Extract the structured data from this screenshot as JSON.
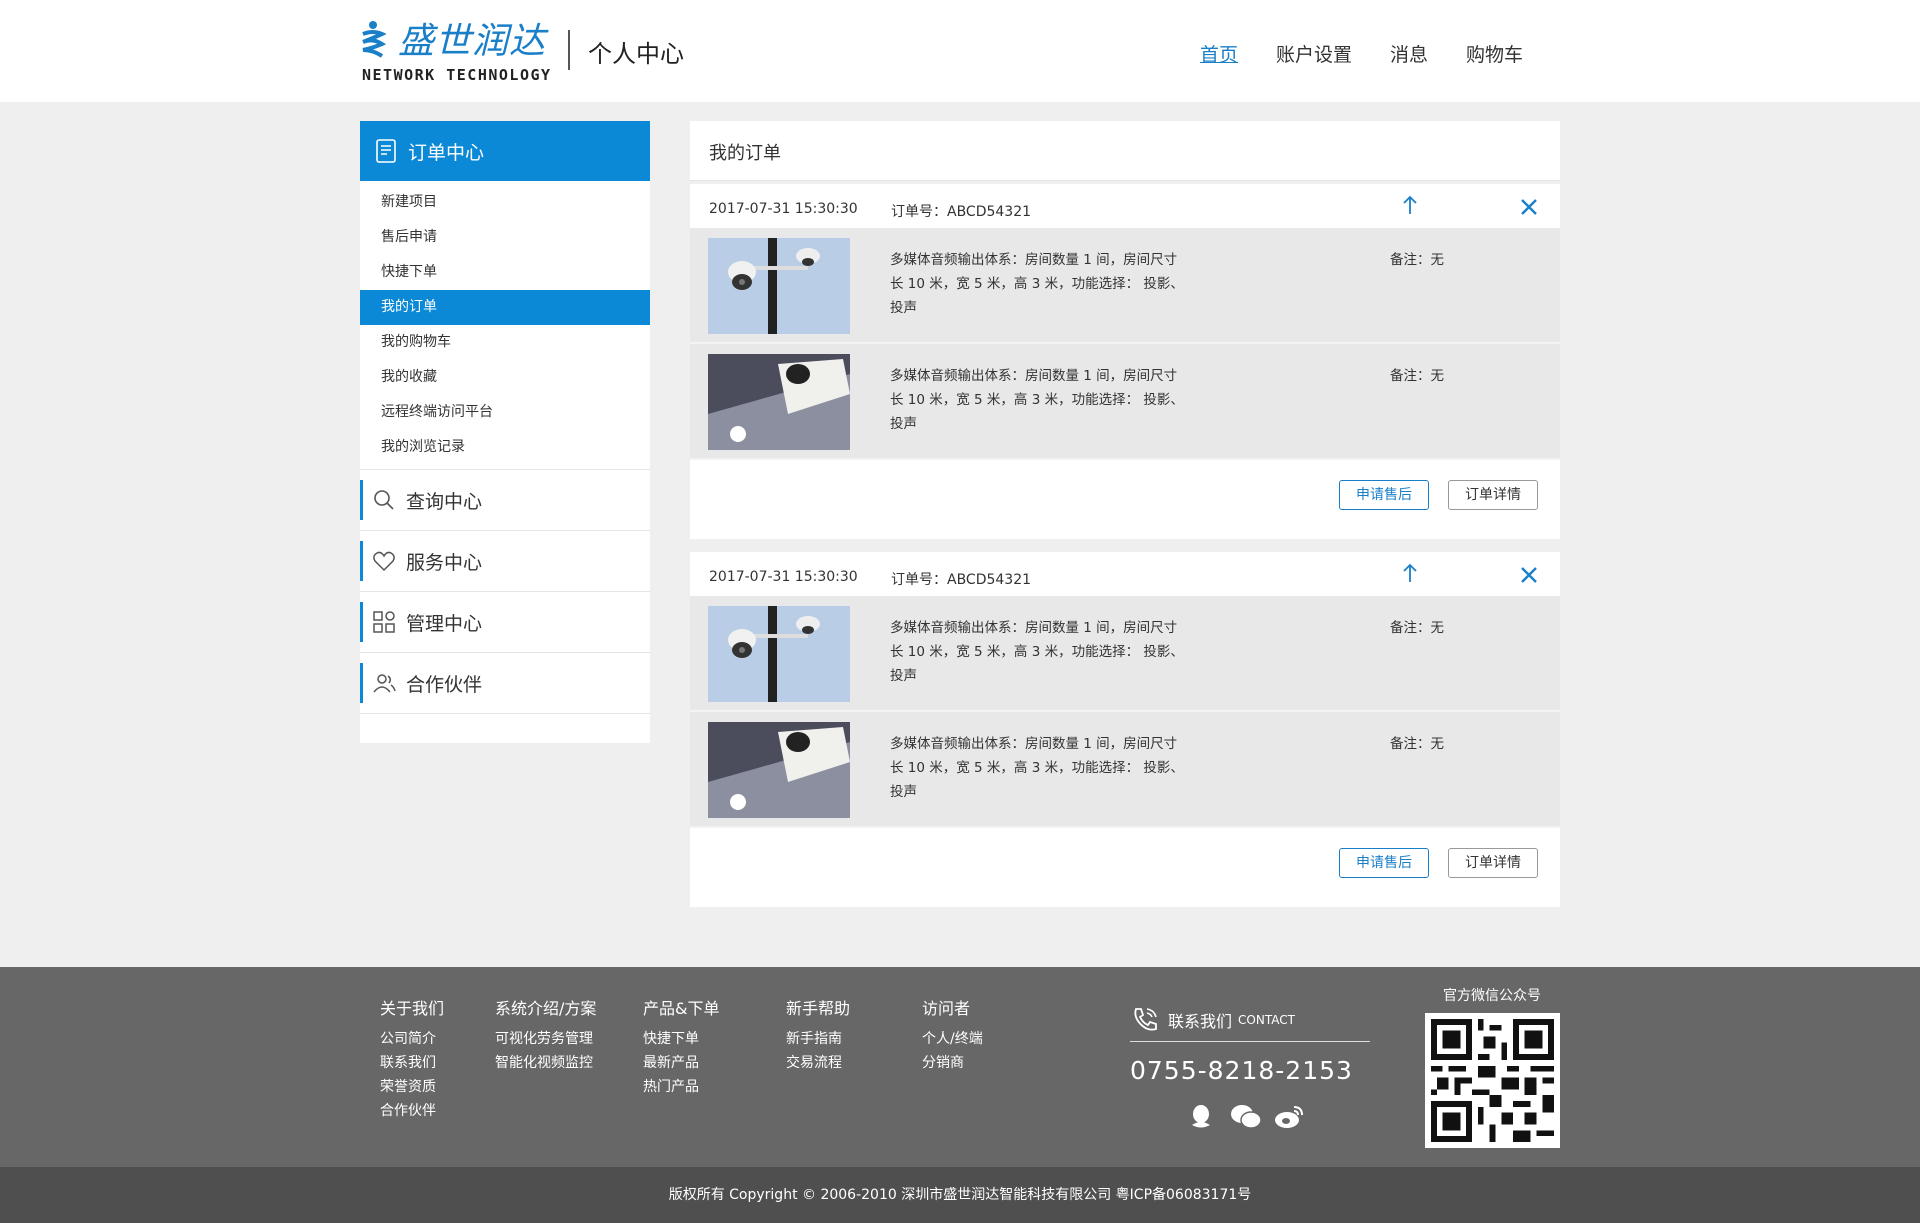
{
  "header": {
    "logo_cn": "盛世润达",
    "logo_en": "NETWORK TECHNOLOGY",
    "page_title": "个人中心",
    "nav": [
      "首页",
      "账户设置",
      "消息",
      "购物车"
    ]
  },
  "sidebar": {
    "head": "订单中心",
    "items": [
      "新建项目",
      "售后申请",
      "快捷下单",
      "我的订单",
      "我的购物车",
      "我的收藏",
      "远程终端访问平台",
      "我的浏览记录"
    ],
    "active_item": "我的订单",
    "sections": [
      "查询中心",
      "服务中心",
      "管理中心",
      "合作伙伴"
    ]
  },
  "main": {
    "title": "我的订单",
    "orders": [
      {
        "date": "2017-07-31 15:30:30",
        "number": "订单号：ABCD54321",
        "items": [
          {
            "desc": "多媒体音频输出体系：房间数量 1 间，房间尺寸长 10 米，宽 5 米，高 3 米，功能选择： 投影、投声",
            "remark": "备注：无"
          },
          {
            "desc": "多媒体音频输出体系：房间数量 1 间，房间尺寸长 10 米，宽 5 米，高 3 米，功能选择： 投影、投声",
            "remark": "备注：无"
          }
        ],
        "btn_after_sale": "申请售后",
        "btn_detail": "订单详情"
      },
      {
        "date": "2017-07-31 15:30:30",
        "number": "订单号：ABCD54321",
        "items": [
          {
            "desc": "多媒体音频输出体系：房间数量 1 间，房间尺寸长 10 米，宽 5 米，高 3 米，功能选择： 投影、投声",
            "remark": "备注：无"
          },
          {
            "desc": "多媒体音频输出体系：房间数量 1 间，房间尺寸长 10 米，宽 5 米，高 3 米，功能选择： 投影、投声",
            "remark": "备注：无"
          }
        ],
        "btn_after_sale": "申请售后",
        "btn_detail": "订单详情"
      }
    ]
  },
  "footer": {
    "columns": [
      {
        "heading": "关于我们",
        "links": [
          "公司简介",
          "联系我们",
          "荣誉资质",
          "合作伙伴"
        ]
      },
      {
        "heading": "系统介绍/方案",
        "links": [
          "可视化劳务管理",
          "智能化视频监控"
        ]
      },
      {
        "heading": "产品&下单",
        "links": [
          "快捷下单",
          "最新产品",
          "热门产品"
        ]
      },
      {
        "heading": "新手帮助",
        "links": [
          "新手指南",
          "交易流程"
        ]
      },
      {
        "heading": "访问者",
        "links": [
          "个人/终端",
          "分销商"
        ]
      }
    ],
    "contact_label": "联系我们",
    "contact_en": "CONTACT",
    "phone": "0755-8218-2153",
    "qr_label": "官方微信公众号",
    "copyright": "版权所有  Copyright © 2006-2010  深圳市盛世润达智能科技有限公司  粤ICP备06083171号"
  },
  "colors": {
    "accent": "#0b88d6",
    "footer_bg": "#676767",
    "copyright_bg": "#4f4f4f"
  },
  "icons": [
    "order-icon",
    "search-icon",
    "heart-icon",
    "grid-icon",
    "users-icon",
    "arrow-up-icon",
    "close-icon",
    "phone-icon",
    "qq-icon",
    "wechat-icon",
    "weibo-icon"
  ]
}
